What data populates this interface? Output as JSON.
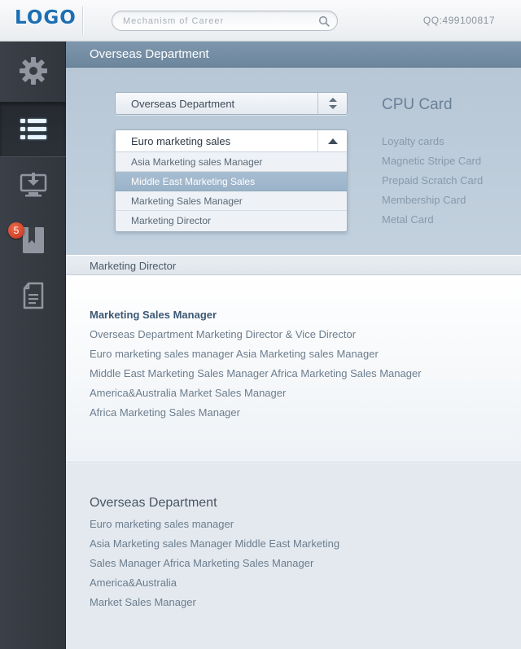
{
  "header": {
    "logo": "LOGO",
    "search_placeholder": "Mechanism of Career",
    "qq": "QQ:499100817"
  },
  "sidebar": {
    "items": [
      {
        "icon": "gear-icon"
      },
      {
        "icon": "list-icon",
        "active": true
      },
      {
        "icon": "monitor-download-icon"
      },
      {
        "icon": "bookmark-icon",
        "badge": "5"
      },
      {
        "icon": "document-icon"
      }
    ]
  },
  "department_header": "Overseas Department",
  "department_select": {
    "value": "Overseas Department"
  },
  "sales_select": {
    "value": "Euro marketing sales",
    "options": [
      "Asia Marketing sales Manager",
      "Middle East Marketing Sales",
      "Marketing Sales Manager",
      "Marketing Director"
    ],
    "highlighted_index": 1
  },
  "cards": {
    "title": "CPU Card",
    "items": [
      "Loyalty cards",
      "Magnetic Stripe Card",
      "Prepaid Scratch Card",
      "Membership Card",
      "Metal Card"
    ]
  },
  "section_bar": "Marketing Director",
  "block1": {
    "title": "Marketing Sales Manager",
    "lines": [
      "Overseas Department Marketing Director & Vice Director",
      "Euro marketing sales manager Asia Marketing sales Manager",
      "Middle East Marketing Sales Manager Africa Marketing Sales Manager",
      "America&Australia Market Sales Manager",
      "Africa Marketing Sales Manager"
    ]
  },
  "block2": {
    "title": "Overseas Department",
    "lines": [
      "Euro marketing sales manager",
      "Asia Marketing sales Manager Middle East Marketing",
      "Sales Manager Africa Marketing Sales Manager",
      "America&Australia",
      "Market Sales Manager"
    ]
  },
  "colors": {
    "accent": "#1d6fb2",
    "sidebar": "#363b42",
    "header_bar": "#7891a7",
    "highlight": "#a3b9ce"
  }
}
